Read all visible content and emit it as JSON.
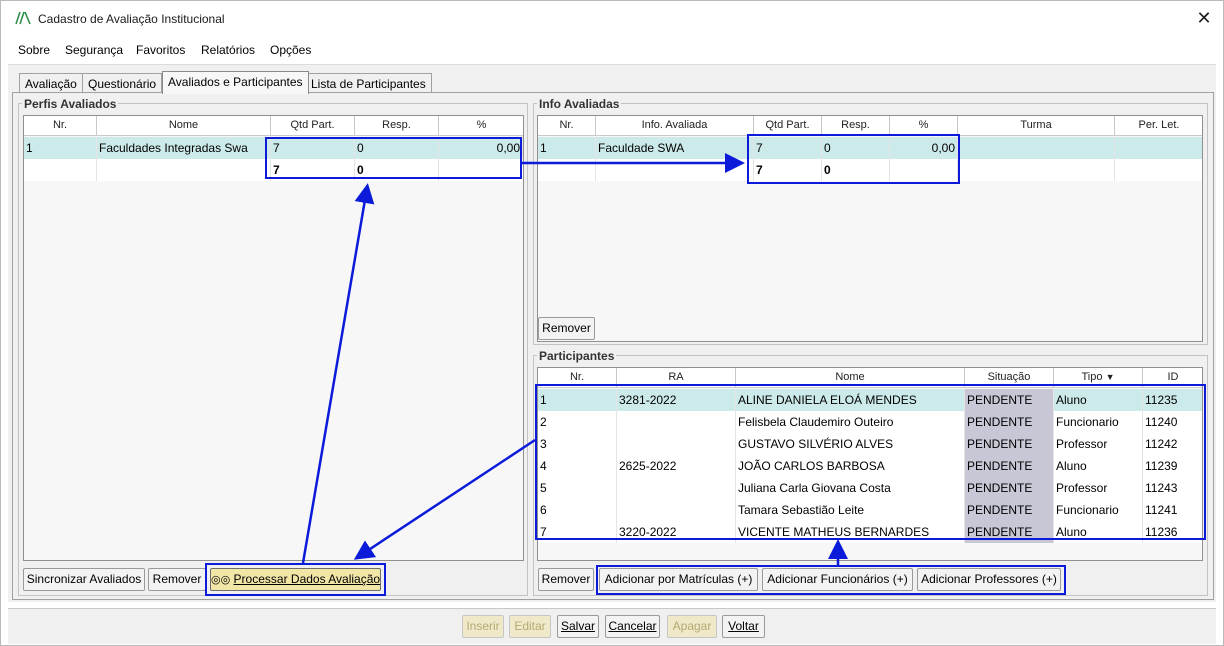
{
  "window": {
    "title": "Cadastro de Avaliação Institucional",
    "close_glyph": "✕"
  },
  "menu": [
    "Sobre",
    "Segurança",
    "Favoritos",
    "Relatórios",
    "Opções"
  ],
  "tabs": [
    "Avaliação",
    "Questionário",
    "Avaliados e Participantes",
    "Lista de Participantes"
  ],
  "perfis": {
    "title": "Perfis Avaliados",
    "columns": [
      "Nr.",
      "Nome",
      "Qtd Part.",
      "Resp.",
      "%"
    ],
    "rows": [
      {
        "nr": "1",
        "nome": "Faculdades Integradas Swa",
        "qtd": "7",
        "resp": "0",
        "pct": "0,00"
      }
    ],
    "totals": {
      "qtd": "7",
      "resp": "0"
    },
    "buttons": {
      "sync": "Sincronizar Avaliados",
      "remove": "Remover",
      "process": "Processar Dados Avaliação"
    }
  },
  "info": {
    "title": "Info Avaliadas",
    "columns": [
      "Nr.",
      "Info. Avaliada",
      "Qtd Part.",
      "Resp.",
      "%",
      "Turma",
      "Per. Let."
    ],
    "rows": [
      {
        "nr": "1",
        "info": "Faculdade SWA",
        "qtd": "7",
        "resp": "0",
        "pct": "0,00",
        "turma": "",
        "per": ""
      }
    ],
    "totals": {
      "qtd": "7",
      "resp": "0"
    },
    "buttons": {
      "remove": "Remover"
    }
  },
  "participantes": {
    "title": "Participantes",
    "columns": [
      "Nr.",
      "RA",
      "Nome",
      "Situação",
      "Tipo",
      "ID"
    ],
    "sort_icon": "▼",
    "rows": [
      {
        "nr": "1",
        "ra": "3281-2022",
        "nome": "ALINE DANIELA ELOÁ MENDES",
        "sit": "PENDENTE",
        "tipo": "Aluno",
        "id": "11235"
      },
      {
        "nr": "2",
        "ra": "",
        "nome": "Felisbela Claudemiro Outeiro",
        "sit": "PENDENTE",
        "tipo": "Funcionario",
        "id": "11240"
      },
      {
        "nr": "3",
        "ra": "",
        "nome": "GUSTAVO SILVÉRIO ALVES",
        "sit": "PENDENTE",
        "tipo": "Professor",
        "id": "11242"
      },
      {
        "nr": "4",
        "ra": "2625-2022",
        "nome": "JOÃO CARLOS BARBOSA",
        "sit": "PENDENTE",
        "tipo": "Aluno",
        "id": "11239"
      },
      {
        "nr": "5",
        "ra": "",
        "nome": "Juliana Carla Giovana Costa",
        "sit": "PENDENTE",
        "tipo": "Professor",
        "id": "11243"
      },
      {
        "nr": "6",
        "ra": "",
        "nome": "Tamara Sebastião Leite",
        "sit": "PENDENTE",
        "tipo": "Funcionario",
        "id": "11241"
      },
      {
        "nr": "7",
        "ra": "3220-2022",
        "nome": "VICENTE MATHEUS BERNARDES",
        "sit": "PENDENTE",
        "tipo": "Aluno",
        "id": "11236"
      }
    ],
    "buttons": {
      "remove": "Remover",
      "add_mat": "Adicionar por Matrículas (+)",
      "add_func": "Adicionar Funcionários (+)",
      "add_prof": "Adicionar Professores (+)"
    }
  },
  "footer": {
    "inserir": "Inserir",
    "editar": "Editar",
    "salvar": "Salvar",
    "cancelar": "Cancelar",
    "apagar": "Apagar",
    "voltar": "Voltar"
  },
  "colors": {
    "selected_row": "#cdeaea",
    "situacao_bg": "#c7c7d6",
    "highlight": "#0b1bd9",
    "primary_button": "#f2e6a6"
  }
}
